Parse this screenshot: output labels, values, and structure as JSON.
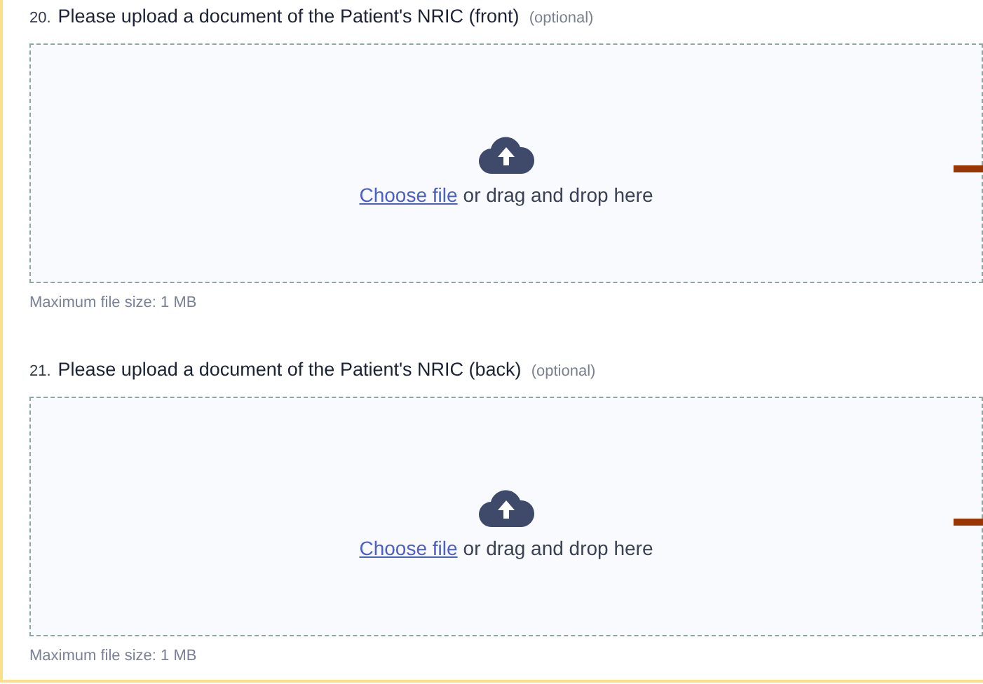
{
  "questions": [
    {
      "number": "20.",
      "title": "Please upload a document of the Patient's NRIC (front)",
      "tag": "(optional)",
      "link": "Choose file",
      "prompt": "or drag and drop here",
      "hint": "Maximum file size: 1 MB"
    },
    {
      "number": "21.",
      "title": "Please upload a document of the Patient's NRIC (back)",
      "tag": "(optional)",
      "link": "Choose file",
      "prompt": "or drag and drop here",
      "hint": "Maximum file size: 1 MB"
    }
  ]
}
